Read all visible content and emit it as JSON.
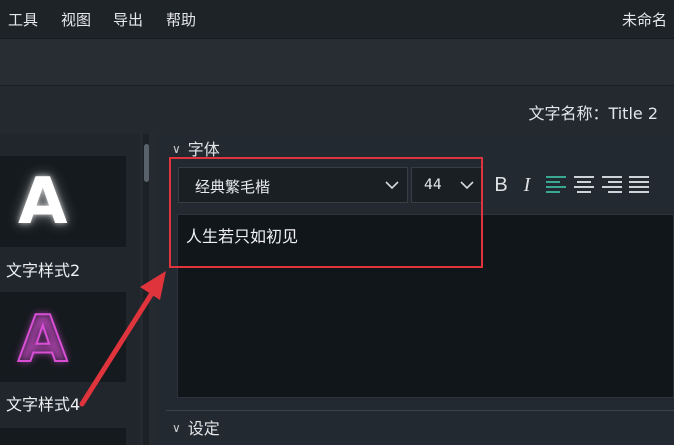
{
  "menu": {
    "items": [
      {
        "label": "工具"
      },
      {
        "label": "视图"
      },
      {
        "label": "导出"
      },
      {
        "label": "帮助"
      }
    ],
    "document_title": "未命名"
  },
  "text_properties": {
    "name_label": "文字名称：Title 2"
  },
  "styles": {
    "items": [
      {
        "preview_letter": "A",
        "label": "文字样式2"
      },
      {
        "preview_letter": "A",
        "label": "文字样式4"
      }
    ]
  },
  "font_section": {
    "heading": "字体",
    "font_family": "经典繁毛楷",
    "font_size": "44",
    "bold_glyph": "B",
    "italic_glyph": "I",
    "alignment_selected": "left",
    "text_content": "人生若只如初见"
  },
  "settings_section": {
    "heading": "设定"
  },
  "colors": {
    "accent_align": "#3aa893",
    "annotation_red": "#e0343c"
  }
}
